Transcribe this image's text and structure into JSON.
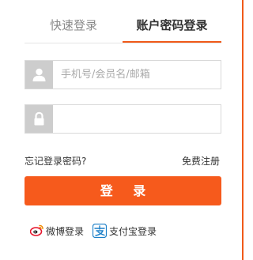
{
  "tabs": {
    "quick_login": "快速登录",
    "account_login": "账户密码登录"
  },
  "form": {
    "username_placeholder": "手机号/会员名/邮箱",
    "username_value": "",
    "password_value": ""
  },
  "links": {
    "forgot_password": "忘记登录密码?",
    "register": "免费注册"
  },
  "login_button": "登 录",
  "social": {
    "weibo_label": "微博登录",
    "alipay_label": "支付宝登录"
  },
  "colors": {
    "accent": "#f65a1c",
    "icon_box": "#cdcdcd",
    "border": "#d9d9d9"
  },
  "icons": {
    "user": "user-icon",
    "lock": "lock-icon",
    "weibo": "weibo-icon",
    "alipay": "alipay-icon"
  }
}
